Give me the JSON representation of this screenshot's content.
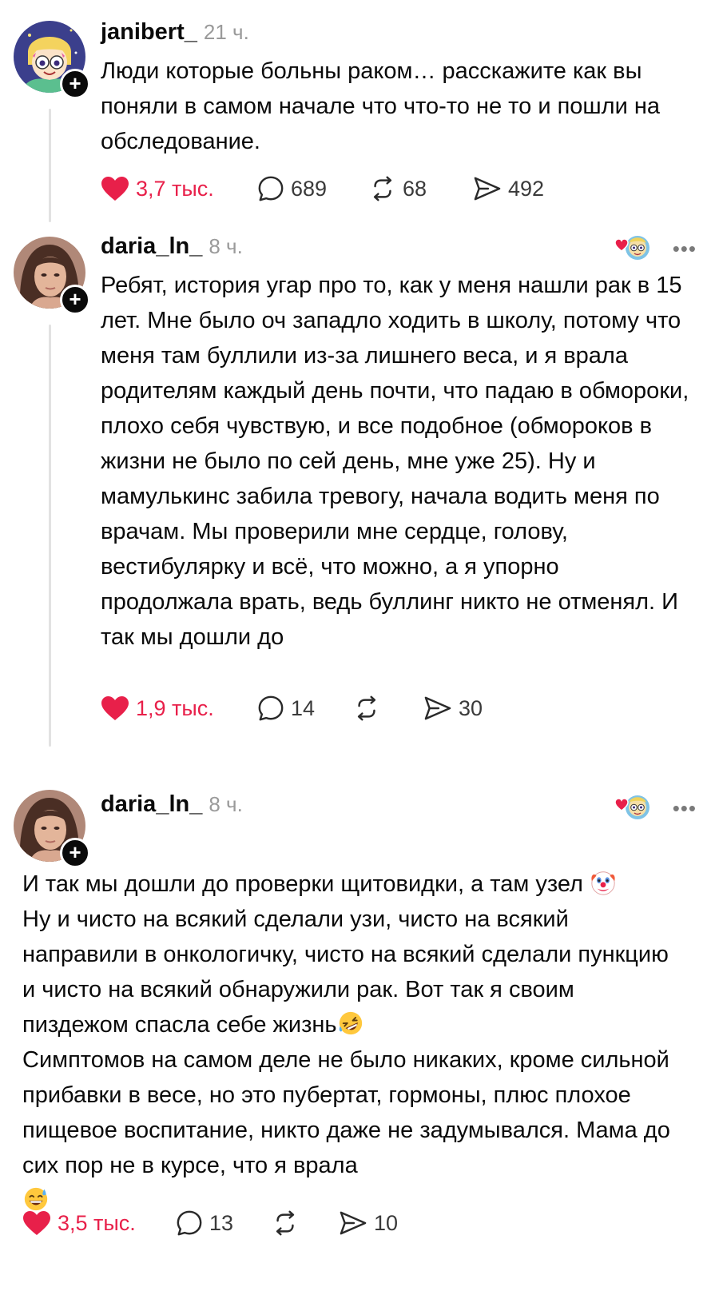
{
  "posts": [
    {
      "username": "janibert_",
      "time": "21 ч.",
      "text": "Люди которые больны раком… расскажите как вы поняли в самом начале что что-то не то и пошли на обследование.",
      "likes": "3,7 тыс.",
      "comments": "689",
      "reposts": "68",
      "shares": "492"
    },
    {
      "username": "daria_ln_",
      "time": "8 ч.",
      "text": "Ребят, история угар про то, как у меня нашли рак в 15 лет. Мне было оч западло ходить в школу, потому что меня там буллили из-за лишнего веса, и я врала родителям каждый день почти, что падаю в обмороки, плохо себя чувствую, и все подобное (обмороков в жизни не было по сей день, мне уже 25). Ну и мамулькинс забила тревогу, начала водить меня по врачам. Мы проверили мне сердце, голову, вестибулярку и всё, что можно, а я упорно продолжала врать, ведь буллинг никто не отменял. И так мы дошли до",
      "likes": "1,9 тыс.",
      "comments": "14",
      "reposts": "",
      "shares": "30"
    },
    {
      "username": "daria_ln_",
      "time": "8 ч.",
      "text_part1": "И так мы дошли до проверки щитовидки, а там узел",
      "text_part2": "Ну и чисто на всякий сделали узи, чисто на всякий направили в онкологичку, чисто на всякий сделали пункцию и чисто на всякий обнаружили рак. Вот так я своим пиздежом спасла себе жизнь",
      "text_part3": "Симптомов на самом деле не было никаких, кроме сильной прибавки в весе, но это пубертат, гормоны, плюс плохое пищевое воспитание, никто даже не задумывался. Мама до сих пор не в курсе, что я врала",
      "likes": "3,5 тыс.",
      "comments": "13",
      "reposts": "",
      "shares": "10"
    }
  ],
  "icons": {
    "follow": "plus-icon",
    "like": "heart-icon",
    "comment": "comment-bubble-icon",
    "repost": "repost-icon",
    "share": "send-icon",
    "more": "more-dots-icon",
    "clown": "clown-emoji",
    "laugh": "rofl-emoji",
    "sweat": "sweat-smile-emoji"
  },
  "follow_symbol": "+",
  "more_symbol": "•••",
  "colors": {
    "like": "#e8204a",
    "text": "#0a0a0a",
    "muted": "#9a9a9a",
    "thread": "#e2e2e2"
  }
}
